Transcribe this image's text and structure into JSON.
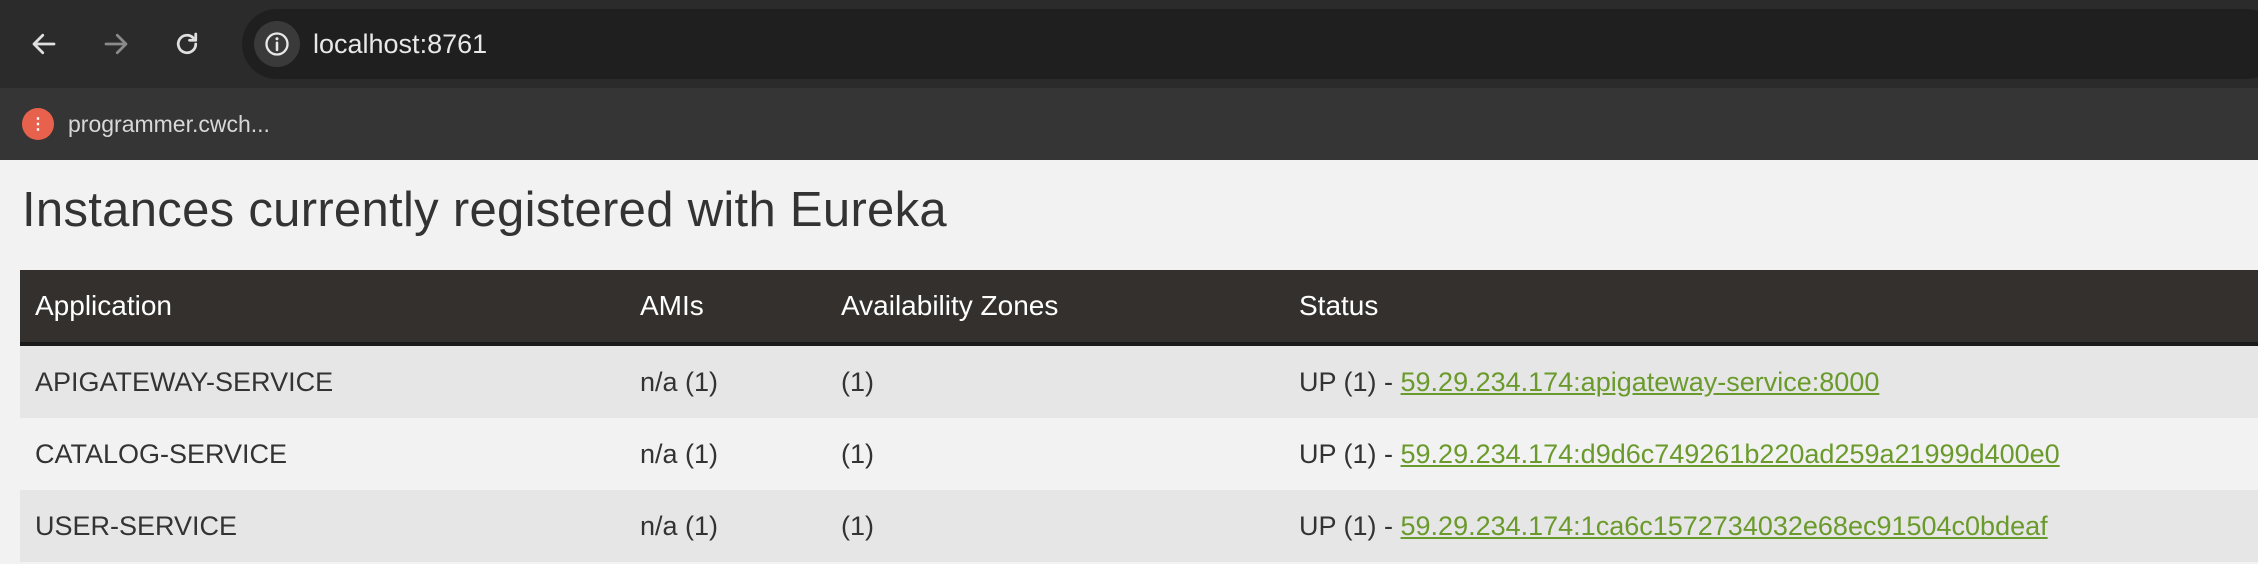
{
  "browser": {
    "url": "localhost:8761",
    "bookmark_label": "programmer.cwch..."
  },
  "page": {
    "title": "Instances currently registered with Eureka"
  },
  "table": {
    "headers": [
      "Application",
      "AMIs",
      "Availability Zones",
      "Status"
    ],
    "rows": [
      {
        "application": "APIGATEWAY-SERVICE",
        "amis": "n/a (1)",
        "zones": "(1)",
        "status_prefix": "UP (1) - ",
        "instance": "59.29.234.174:apigateway-service:8000"
      },
      {
        "application": "CATALOG-SERVICE",
        "amis": "n/a (1)",
        "zones": "(1)",
        "status_prefix": "UP (1) - ",
        "instance": "59.29.234.174:d9d6c749261b220ad259a21999d400e0"
      },
      {
        "application": "USER-SERVICE",
        "amis": "n/a (1)",
        "zones": "(1)",
        "status_prefix": "UP (1) - ",
        "instance": "59.29.234.174:1ca6c1572734032e68ec91504c0bdeaf"
      }
    ]
  },
  "colors": {
    "header_bg": "#34302d",
    "link": "#6a9a2b",
    "favicon": "#e8614d"
  }
}
